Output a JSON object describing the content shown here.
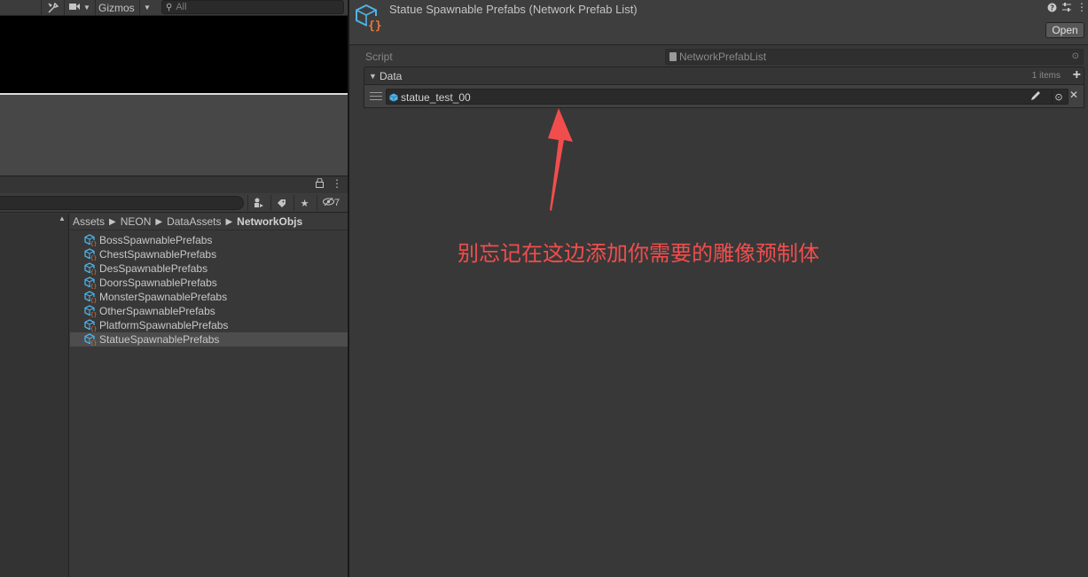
{
  "scene": {
    "gizmos_label": "Gizmos",
    "search_placeholder": "All"
  },
  "project": {
    "hidden_count": "7",
    "breadcrumb": [
      "Assets",
      "NEON",
      "DataAssets",
      "NetworkObjs"
    ],
    "assets": [
      {
        "name": "BossSpawnablePrefabs",
        "selected": false
      },
      {
        "name": "ChestSpawnablePrefabs",
        "selected": false
      },
      {
        "name": "DesSpawnablePrefabs",
        "selected": false
      },
      {
        "name": "DoorsSpawnablePrefabs",
        "selected": false
      },
      {
        "name": "MonsterSpawnablePrefabs",
        "selected": false
      },
      {
        "name": "OtherSpawnablePrefabs",
        "selected": false
      },
      {
        "name": "PlatformSpawnablePrefabs",
        "selected": false
      },
      {
        "name": "StatueSpawnablePrefabs",
        "selected": true
      }
    ]
  },
  "inspector": {
    "title": "Statue Spawnable Prefabs (Network Prefab List)",
    "open_label": "Open",
    "script_label": "Script",
    "script_value": "NetworkPrefabList",
    "data_label": "Data",
    "items_count": "1 items",
    "elements": [
      "statue_test_00"
    ]
  },
  "annotation": {
    "text": "别忘记在这边添加你需要的雕像预制体",
    "color": "#f24d4d"
  },
  "colors": {
    "accent_icon": "#4fb3e8",
    "icon_braces": "#e8793c"
  }
}
